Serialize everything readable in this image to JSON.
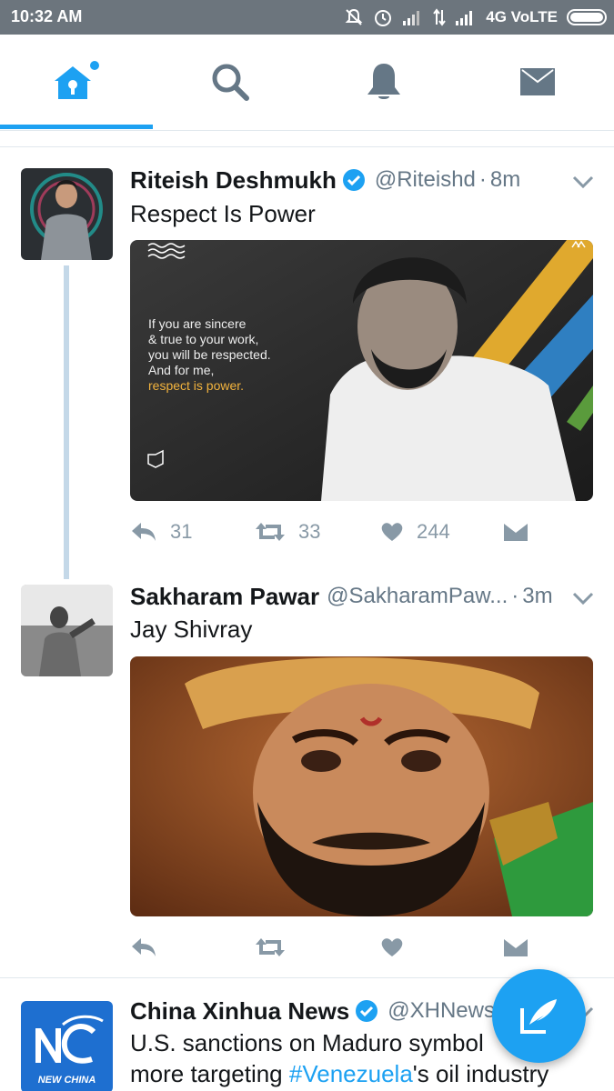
{
  "status_bar": {
    "time": "10:32 AM",
    "network": "4G VoLTE"
  },
  "tabs": [
    {
      "name": "home",
      "icon": "home-icon",
      "active": true
    },
    {
      "name": "search",
      "icon": "search-icon",
      "active": false
    },
    {
      "name": "notifications",
      "icon": "bell-icon",
      "active": false
    },
    {
      "name": "messages",
      "icon": "envelope-icon",
      "active": false
    }
  ],
  "tweets": [
    {
      "name": "Riteish Deshmukh",
      "verified": true,
      "handle": "@Riteishd",
      "time": "8m",
      "text": "Respect Is Power",
      "media_quote": {
        "line1": "If you are sincere",
        "line2": "& true to your work,",
        "line3": "you will be respected.",
        "line4": "And for me,",
        "line5": "respect is power."
      },
      "replies": "31",
      "retweets": "33",
      "likes": "244"
    },
    {
      "name": "Sakharam Pawar",
      "verified": false,
      "handle": "@SakharamPaw...",
      "time": "3m",
      "text": "Jay Shivray",
      "replies": "",
      "retweets": "",
      "likes": ""
    },
    {
      "name": "China Xinhua News",
      "verified": true,
      "handle": "@XHNews",
      "avatar_text": "NEW CHINA",
      "text_line1": "U.S. sanctions on Maduro symbol",
      "text_line2_pre": "more targeting ",
      "text_line2_tag": "#Venezuela",
      "text_line2_post": "'s oil industry"
    }
  ],
  "colors": {
    "accent": "#1da1f2",
    "status_bar": "#6c757d",
    "muted": "#8899a6",
    "thread_line": "#c4d8e8"
  }
}
